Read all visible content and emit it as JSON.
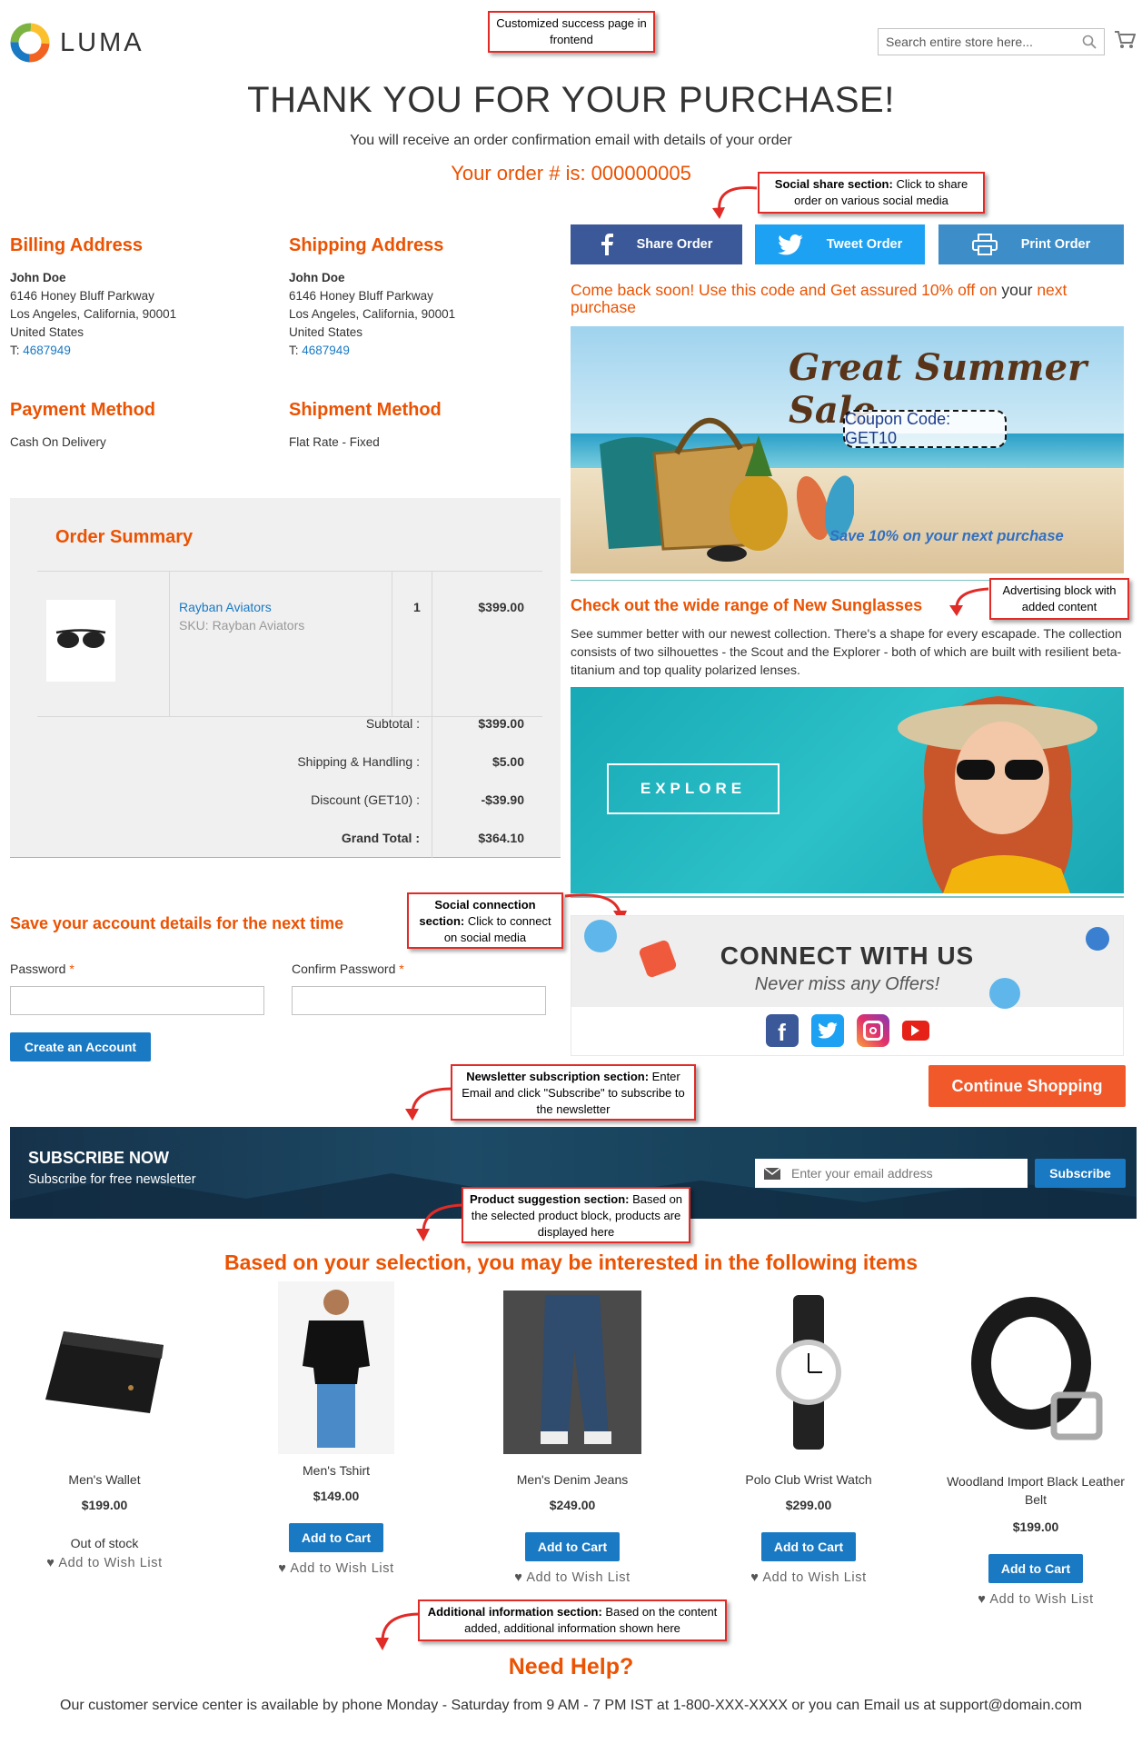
{
  "header": {
    "logo_text": "LUMA",
    "search_placeholder": "Search entire store here...",
    "cart_icon": "cart-icon"
  },
  "callouts": {
    "success_page": "Customized success page in frontend",
    "social_share_bold": "Social share section:",
    "social_share_text": " Click to share order on various social media",
    "advertising": "Advertising block with added content",
    "social_connection_bold": "Social connection section:",
    "social_connection_text": " Click to connect on social media",
    "newsletter_bold": "Newsletter subscription section:",
    "newsletter_text": " Enter Email and click \"Subscribe\" to subscribe to the newsletter",
    "product_bold": "Product suggestion section:",
    "product_text": " Based on the selected product block, products are displayed here",
    "additional_bold": "Additional information section:",
    "additional_text": " Based on the content added, additional information shown here"
  },
  "page": {
    "title": "THANK YOU FOR YOUR PURCHASE!",
    "subtitle": "You will receive an order confirmation email with details of your order",
    "order_number": "Your order # is: 000000005"
  },
  "billing": {
    "title": "Billing Address",
    "name": "John Doe",
    "street": "6146 Honey Bluff Parkway",
    "city": "Los Angeles, California, 90001",
    "country": "United States",
    "phone_prefix": "T: ",
    "phone": "4687949"
  },
  "shipping": {
    "title": "Shipping Address",
    "name": "John Doe",
    "street": "6146 Honey Bluff Parkway",
    "city": "Los Angeles, California, 90001",
    "country": "United States",
    "phone_prefix": "T: ",
    "phone": "4687949"
  },
  "payment": {
    "title": "Payment Method",
    "value": "Cash On Delivery"
  },
  "shipment": {
    "title": "Shipment Method",
    "value": "Flat Rate - Fixed"
  },
  "order_summary": {
    "title": "Order Summary",
    "item_name": "Rayban Aviators",
    "item_sku": "SKU: Rayban Aviators",
    "item_qty": "1",
    "item_price": "$399.00",
    "subtotal_label": "Subtotal :",
    "subtotal": "$399.00",
    "shipping_label": "Shipping & Handling :",
    "shipping": "$5.00",
    "discount_label": "Discount (GET10) :",
    "discount": "-$39.90",
    "grand_label": "Grand Total :",
    "grand": "$364.10"
  },
  "share": {
    "facebook": "Share Order",
    "twitter": "Tweet Order",
    "print": "Print Order",
    "facebook_color": "#3b5998",
    "twitter_color": "#1da1f2",
    "print_color": "#3c8dc8"
  },
  "promo": {
    "text_before": "Come back soon! Use this code and Get assured 10% off on ",
    "text_your": "your",
    "text_after": " next purchase",
    "banner_title": "Great Summer Sale",
    "coupon": "Coupon Code: GET10",
    "save": "Save 10% on your next purchase"
  },
  "sunglasses": {
    "title": "Check out the wide range of New Sunglasses",
    "body": "See summer better with our newest collection. There's a shape for every escapade. The collection consists of two silhouettes - the Scout and the Explorer - both of which are built with resilient beta-titanium and top quality polarized lenses.",
    "explore": "EXPLORE"
  },
  "connect": {
    "title": "CONNECT WITH US",
    "subtitle": "Never miss any Offers!"
  },
  "account": {
    "title": "Save your account details for the next time",
    "password_label": "Password",
    "confirm_label": "Confirm Password",
    "required": "*",
    "create_button": "Create an Account"
  },
  "continue_button": "Continue Shopping",
  "newsletter": {
    "title": "SUBSCRIBE NOW",
    "subtitle": "Subscribe for free newsletter",
    "placeholder": "Enter your email address",
    "button": "Subscribe"
  },
  "suggestions": {
    "title": "Based on your selection, you may be interested in the following items",
    "add_to_cart": "Add to Cart",
    "wishlist": "Add to Wish List",
    "out_of_stock": "Out of stock",
    "products": [
      {
        "name": "Men's Wallet",
        "price": "$199.00"
      },
      {
        "name": "Men's Tshirt",
        "price": "$149.00"
      },
      {
        "name": "Men's Denim Jeans",
        "price": "$249.00"
      },
      {
        "name": "Polo Club Wrist Watch",
        "price": "$299.00"
      },
      {
        "name": "Woodland Import Black Leather Belt",
        "price": "$199.00"
      }
    ]
  },
  "help": {
    "title": "Need Help?",
    "text": "Our customer service center is available by phone Monday - Saturday from 9 AM - 7 PM IST at 1-800-XXX-XXXX or you can Email us at support@domain.com"
  }
}
